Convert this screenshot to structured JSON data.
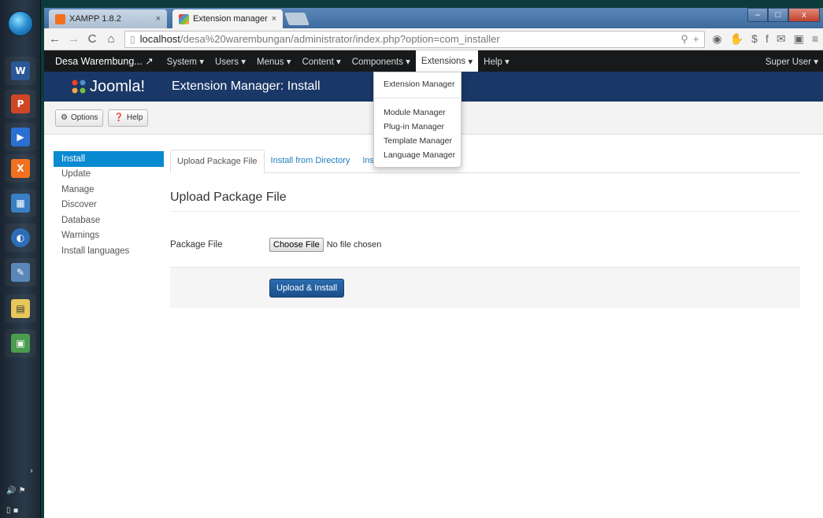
{
  "browser": {
    "tabs": [
      {
        "title": "XAMPP 1.8.2",
        "close": "×"
      },
      {
        "title": "Extension manager - Insta",
        "close": "×"
      }
    ],
    "window_buttons": [
      "–",
      "□",
      "x"
    ],
    "address": {
      "host": "localhost",
      "path": "/desa%20warembungan/administrator/index.php?option=com_installer"
    }
  },
  "joomla": {
    "site_name": "Desa Warembung...",
    "menus": [
      "System",
      "Users",
      "Menus",
      "Content",
      "Components",
      "Extensions",
      "Help"
    ],
    "user": "Super User",
    "logo_text": "Joomla!",
    "page_title": "Extension Manager: Install",
    "toolbar": {
      "options": "Options",
      "help": "Help"
    },
    "sidebar": [
      "Install",
      "Update",
      "Manage",
      "Discover",
      "Database",
      "Warnings",
      "Install languages"
    ],
    "content_tabs": [
      "Upload Package File",
      "Install from Directory",
      "Install fr"
    ],
    "section_title": "Upload Package File",
    "package_label": "Package File",
    "choose_file": "Choose File",
    "no_file": "No file chosen",
    "upload_button": "Upload & Install",
    "dropdown": {
      "top": "Extension Manager",
      "items": [
        "Module Manager",
        "Plug-in Manager",
        "Template Manager",
        "Language Manager"
      ]
    }
  },
  "colors": {
    "joomla_header": "#1a3867",
    "navbar": "#17191b",
    "active_sidebar": "#0a8ad0",
    "primary_button": "#1b4f8a"
  }
}
